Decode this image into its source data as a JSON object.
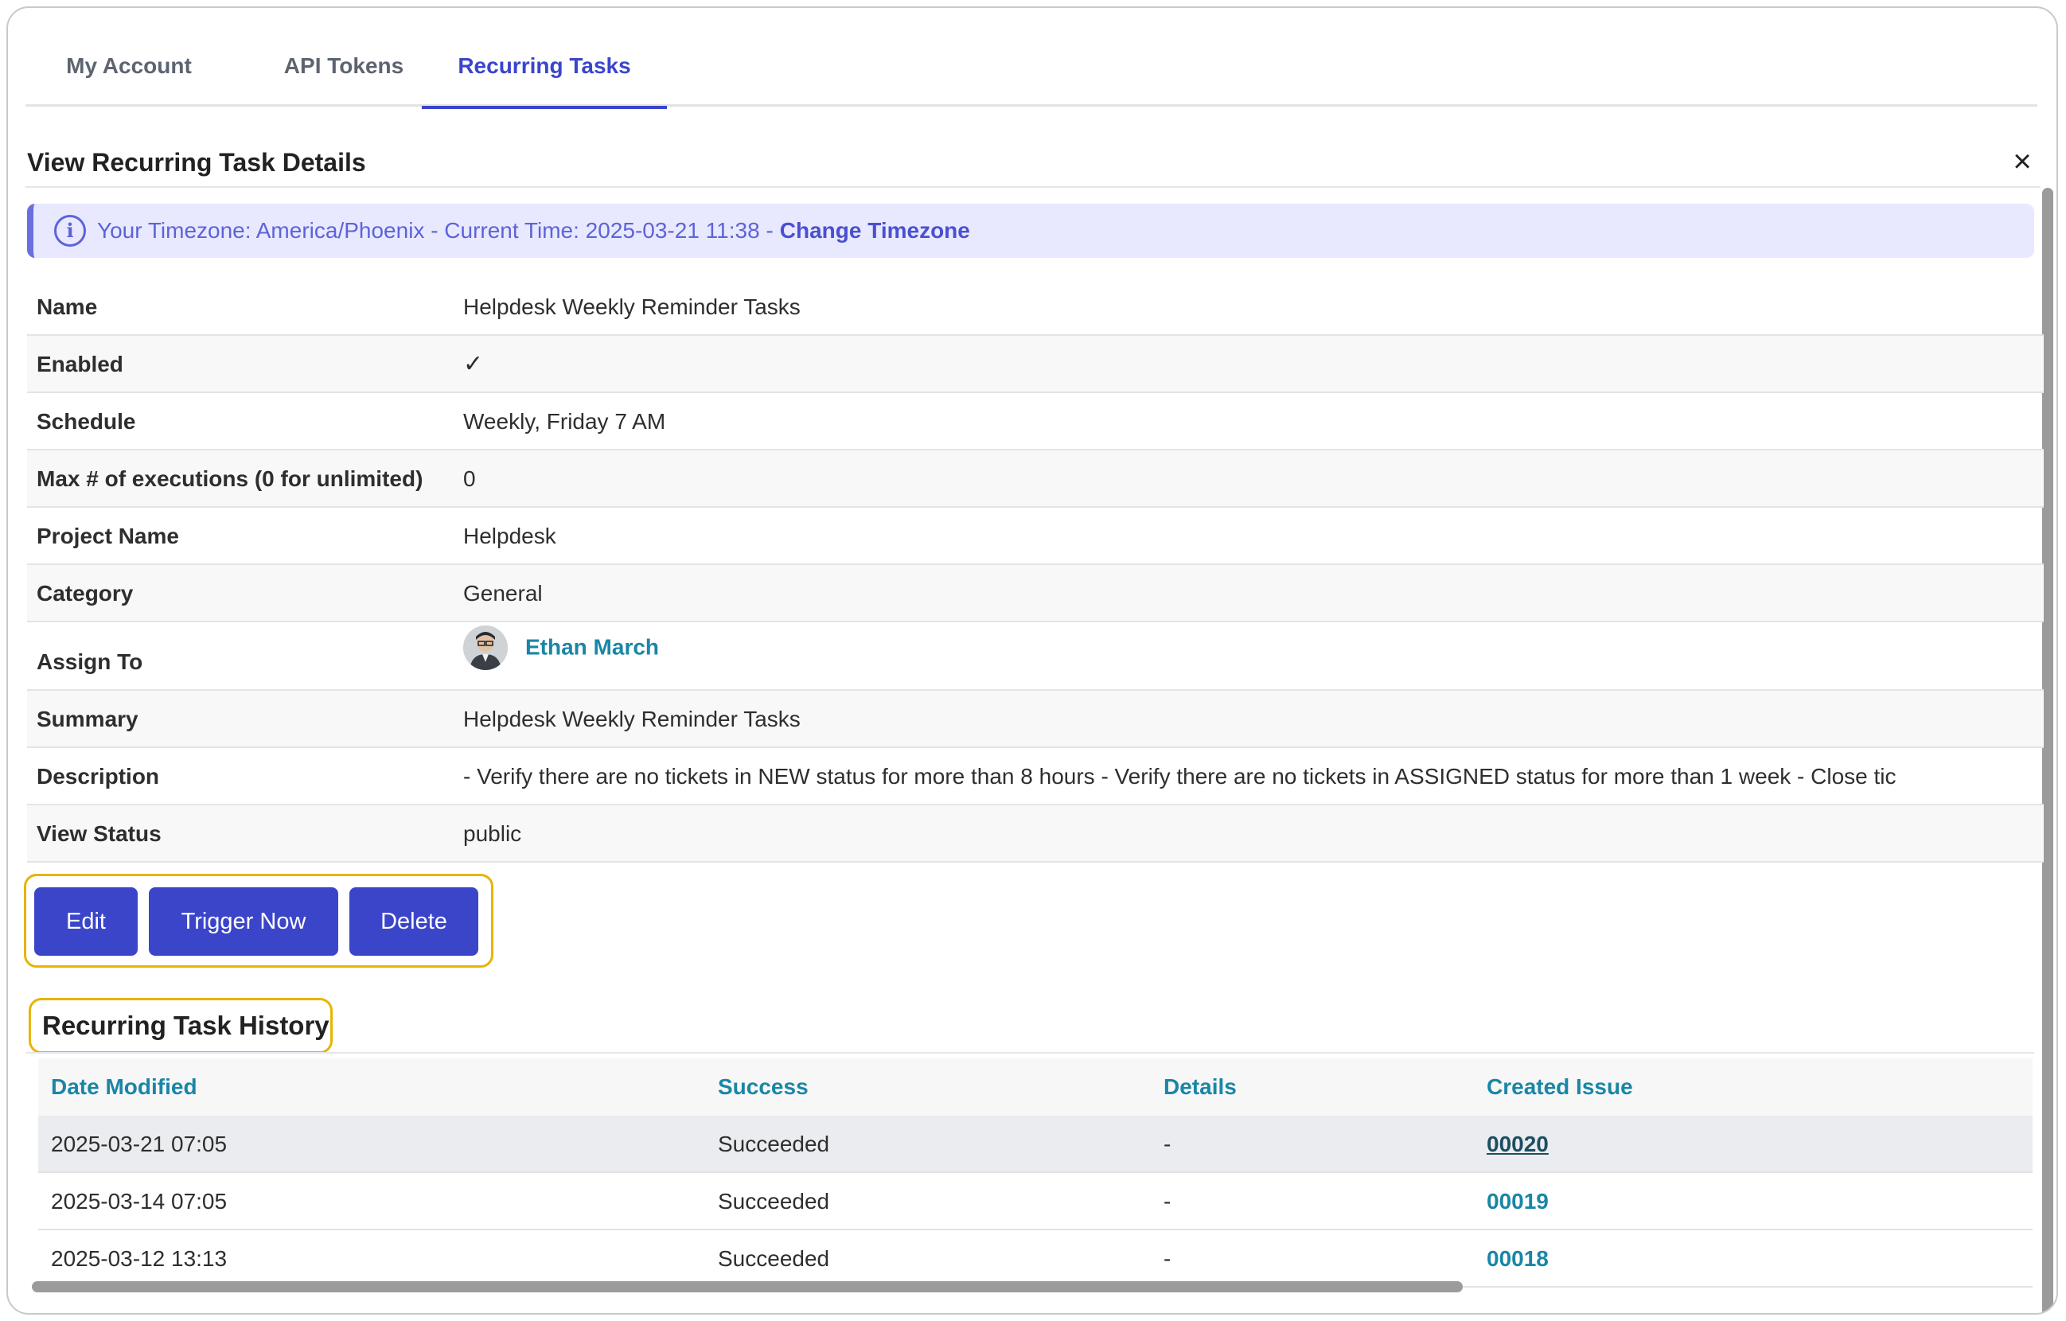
{
  "tabs": [
    {
      "label": "My Account"
    },
    {
      "label": "API Tokens"
    },
    {
      "label": "Recurring Tasks"
    }
  ],
  "section": {
    "title": "View Recurring Task Details",
    "close_icon": "close-icon"
  },
  "banner": {
    "text": "Your Timezone: America/Phoenix - Current Time: 2025-03-21 11:38 -",
    "link": "Change Timezone",
    "icon_glyph": "i"
  },
  "details": [
    {
      "label": "Name",
      "value": "Helpdesk Weekly Reminder Tasks"
    },
    {
      "label": "Enabled",
      "value": "✓"
    },
    {
      "label": "Schedule",
      "value": "Weekly, Friday 7 AM"
    },
    {
      "label": "Max # of executions (0 for unlimited)",
      "value": "0"
    },
    {
      "label": "Project Name",
      "value": "Helpdesk"
    },
    {
      "label": "Category",
      "value": "General"
    },
    {
      "label": "Assign To",
      "value": "Ethan March"
    },
    {
      "label": "Summary",
      "value": "Helpdesk Weekly Reminder Tasks"
    },
    {
      "label": "Description",
      "value": "- Verify there are no tickets in NEW status for more than 8 hours - Verify there are no tickets in ASSIGNED status for more than 1 week - Close tic"
    },
    {
      "label": "View Status",
      "value": "public"
    }
  ],
  "actions": {
    "edit": "Edit",
    "trigger": "Trigger Now",
    "delete": "Delete"
  },
  "history": {
    "title": "Recurring Task History",
    "columns": [
      "Date Modified",
      "Success",
      "Details",
      "Created Issue"
    ],
    "rows": [
      {
        "date": "2025-03-21 07:05",
        "success": "Succeeded",
        "details": "-",
        "issue": "00020"
      },
      {
        "date": "2025-03-14 07:05",
        "success": "Succeeded",
        "details": "-",
        "issue": "00019"
      },
      {
        "date": "2025-03-12 13:13",
        "success": "Succeeded",
        "details": "-",
        "issue": "00018"
      }
    ]
  }
}
